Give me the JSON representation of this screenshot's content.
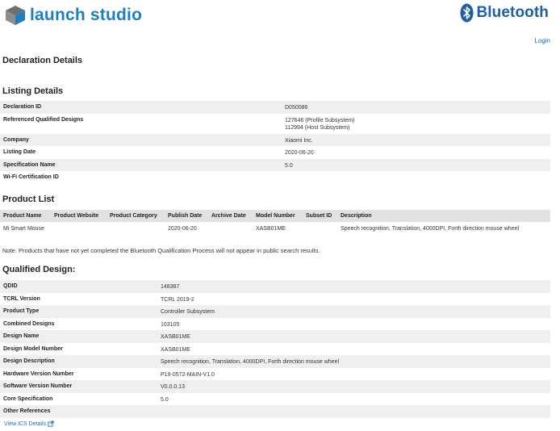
{
  "header": {
    "brand_left": "launch studio",
    "brand_right": "Bluetooth",
    "login": "Login"
  },
  "colors": {
    "brand_blue": "#1d7fc1",
    "bluetooth_blue": "#1b5faa",
    "link": "#1d6fb8",
    "row_alt": "#efefef",
    "table_header": "#e2e2e2"
  },
  "page_title": "Declaration Details",
  "listing": {
    "title": "Listing Details",
    "rows": [
      {
        "label": "Declaration ID",
        "value": "D050086"
      },
      {
        "label": "Referenced Qualified Designs",
        "value": "127646 (Profile Subsystem)",
        "value2": "112994 (Host Subsystem)"
      },
      {
        "label": "Company",
        "value": "Xiaomi Inc."
      },
      {
        "label": "Listing Date",
        "value": "2020-06-20"
      },
      {
        "label": "Specification Name",
        "value": "5.0"
      },
      {
        "label": "Wi-Fi Certification ID",
        "value": ""
      }
    ]
  },
  "product_list": {
    "title": "Product List",
    "columns": [
      "Product Name",
      "Product Website",
      "Product Category",
      "Publish Date",
      "Archive Date",
      "Model Number",
      "Subset ID",
      "Description"
    ],
    "rows": [
      {
        "product_name": "Mi Smart Mouse",
        "product_website": "",
        "product_category": "",
        "publish_date": "2020-06-20",
        "archive_date": "",
        "model_number": "XASB01ME",
        "subset_id": "",
        "description": "Speech recognition, Translation, 4000DPI, Forth direction mouse wheel"
      }
    ],
    "note": "Note: Products that have not yet completed the Bluetooth Qualification Process will not appear in public search results."
  },
  "qualified": {
    "title": "Qualified Design:",
    "rows": [
      {
        "label": "QDID",
        "value": "148387"
      },
      {
        "label": "TCRL Version",
        "value": "TCRL 2019-2"
      },
      {
        "label": "Product Type",
        "value": "Controller Subsystem"
      },
      {
        "label": "Combined Designs",
        "value": "103105"
      },
      {
        "label": "Design Name",
        "value": "XASB01ME"
      },
      {
        "label": "Design Model Number",
        "value": "XASB01ME"
      },
      {
        "label": "Design Description",
        "value": "Speech recognition, Translation, 4000DPI, Forth direction mouse wheel"
      },
      {
        "label": "Hardware Version Number",
        "value": "P19-0572-MAIN-V1.0"
      },
      {
        "label": "Software Version Number",
        "value": "V0.0.0.13"
      },
      {
        "label": "Core Specification",
        "value": "5.0"
      },
      {
        "label": "Other References",
        "value": ""
      }
    ],
    "ics_link": "View ICS Details"
  }
}
